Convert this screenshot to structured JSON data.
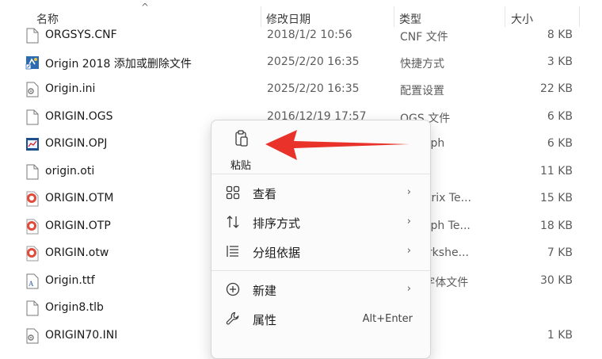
{
  "columns": {
    "name": "名称",
    "date": "修改日期",
    "type": "类型",
    "size": "大小"
  },
  "files": [
    {
      "name": "ORGSYS.CNF",
      "date": "2018/1/2 10:56",
      "type": "CNF 文件",
      "size": "8 KB",
      "icon": "generic-file-icon"
    },
    {
      "name": "Origin 2018 添加或删除文件",
      "date": "2025/2/20 16:35",
      "type": "快捷方式",
      "size": "3 KB",
      "icon": "shortcut-icon"
    },
    {
      "name": "Origin.ini",
      "date": "2025/2/20 16:35",
      "type": "配置设置",
      "size": "22 KB",
      "icon": "settings-file-icon"
    },
    {
      "name": "ORIGIN.OGS",
      "date": "2016/12/19 17:57",
      "type": "OGS 文件",
      "size": "6 KB",
      "icon": "generic-file-icon"
    },
    {
      "name": "ORIGIN.OPJ",
      "date": "",
      "type": "n Graph",
      "size": "6 KB",
      "icon": "graph-file-icon"
    },
    {
      "name": "origin.oti",
      "date": "",
      "type": "文件",
      "size": "11 KB",
      "icon": "generic-file-icon"
    },
    {
      "name": "ORIGIN.OTM",
      "date": "",
      "type": "n Matrix Te...",
      "size": "15 KB",
      "icon": "origin-template-icon"
    },
    {
      "name": "ORIGIN.OTP",
      "date": "",
      "type": "n Graph Te...",
      "size": "18 KB",
      "icon": "origin-template-icon"
    },
    {
      "name": "ORIGIN.otw",
      "date": "",
      "type": "n Workshe...",
      "size": "7 KB",
      "icon": "origin-template-icon"
    },
    {
      "name": "Origin.ttf",
      "date": "",
      "type": "ype 字体文件",
      "size": "30 KB",
      "icon": "font-file-icon"
    },
    {
      "name": "Origin8.tlb",
      "date": "",
      "type": "",
      "size": "",
      "icon": "generic-file-icon"
    },
    {
      "name": "ORIGIN70.INI",
      "date": "",
      "type": "设置",
      "size": "1 KB",
      "icon": "settings-file-icon"
    }
  ],
  "context_menu": {
    "paste_label": "粘贴",
    "items": [
      {
        "label": "查看",
        "shortcut": "",
        "submenu": true,
        "icon": "grid-view-icon"
      },
      {
        "label": "排序方式",
        "shortcut": "",
        "submenu": true,
        "icon": "sort-icon"
      },
      {
        "label": "分组依据",
        "shortcut": "",
        "submenu": true,
        "icon": "group-list-icon"
      },
      {
        "label": "新建",
        "shortcut": "",
        "submenu": true,
        "icon": "new-plus-icon"
      },
      {
        "label": "属性",
        "shortcut": "Alt+Enter",
        "submenu": false,
        "icon": "wrench-icon"
      }
    ],
    "submenu_arrow": "›"
  },
  "sort_indicator": "^",
  "annotation_color": "#e8322a"
}
